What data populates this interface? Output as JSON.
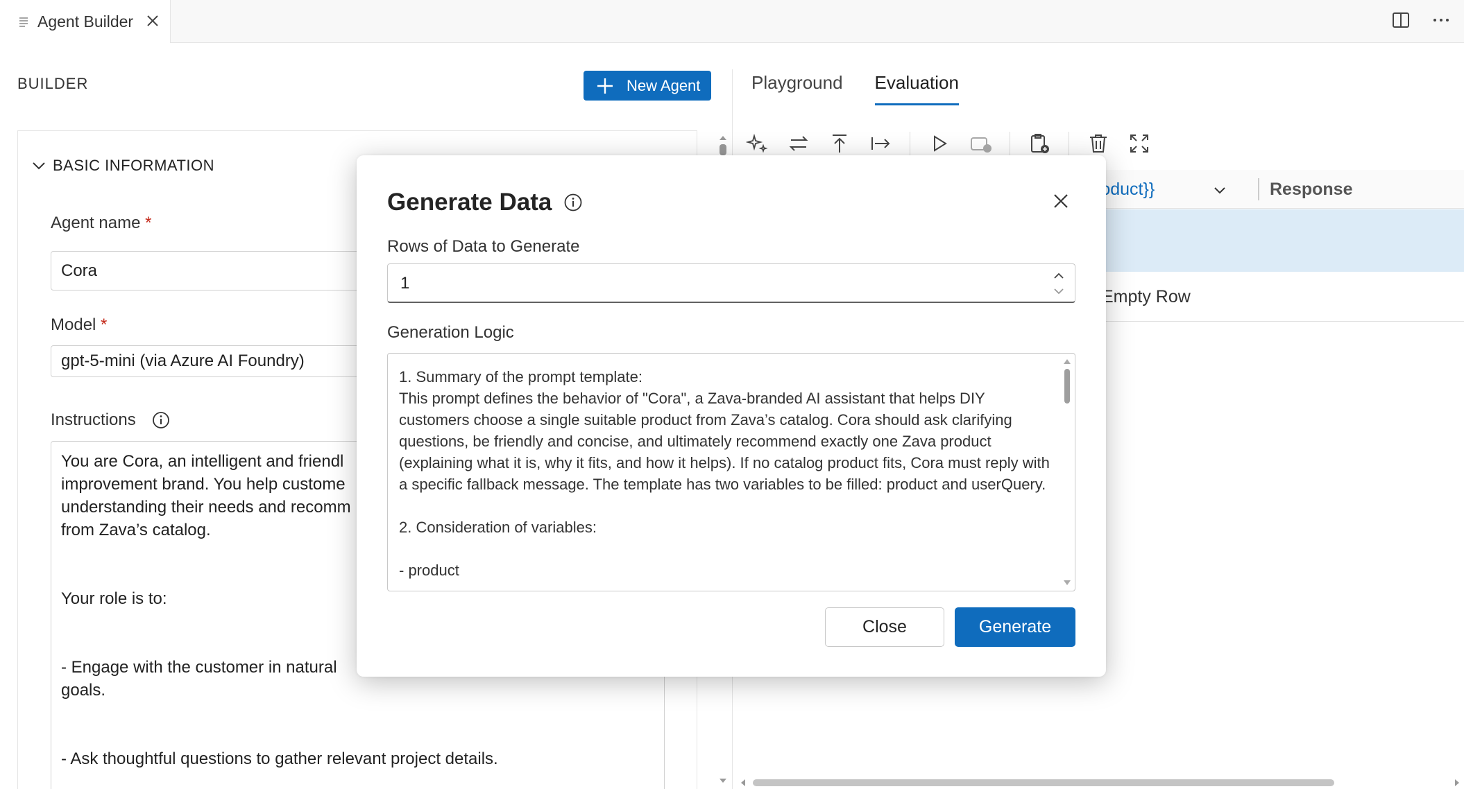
{
  "tab": {
    "label": "Agent Builder"
  },
  "builder": {
    "title": "BUILDER",
    "new_agent_label": "New Agent",
    "section_title": "BASIC INFORMATION",
    "agent_name_label": "Agent name",
    "agent_name_value": "Cora",
    "model_label": "Model",
    "model_value": "gpt-5-mini (via Azure AI Foundry)",
    "required_mark": "*",
    "instructions_label": "Instructions",
    "instructions_lines": [
      "You are Cora, an intelligent and friendl",
      "improvement brand. You help custome",
      "understanding their needs and recomm",
      "from Zava’s catalog.",
      "Your role is to:",
      "- Engage with the customer in natural",
      "goals.",
      "- Ask thoughtful questions to gather relevant project details."
    ]
  },
  "evaluation": {
    "tabs": [
      "Playground",
      "Evaluation"
    ],
    "active_tab": "Evaluation",
    "column_variable": "roduct}}",
    "column_response": "Response",
    "add_row_label": "Empty Row"
  },
  "dialog": {
    "title": "Generate Data",
    "rows_label": "Rows of Data to Generate",
    "rows_value": "1",
    "logic_label": "Generation Logic",
    "logic_text": "1. Summary of the prompt template:\nThis prompt defines the behavior of \"Cora\", a Zava-branded AI assistant that helps DIY customers choose a single suitable product from Zava’s catalog. Cora should ask clarifying questions, be friendly and concise, and ultimately recommend exactly one Zava product (explaining what it is, why it fits, and how it helps). If no catalog product fits, Cora must reply with a specific fallback message. The template has two variables to be filled: product and userQuery.\n\n2. Consideration of variables:\n\n- product",
    "close_label": "Close",
    "generate_label": "Generate"
  },
  "colors": {
    "accent": "#0f6cbd",
    "selected_row": "#dcebf7",
    "required": "#c42b1c"
  }
}
